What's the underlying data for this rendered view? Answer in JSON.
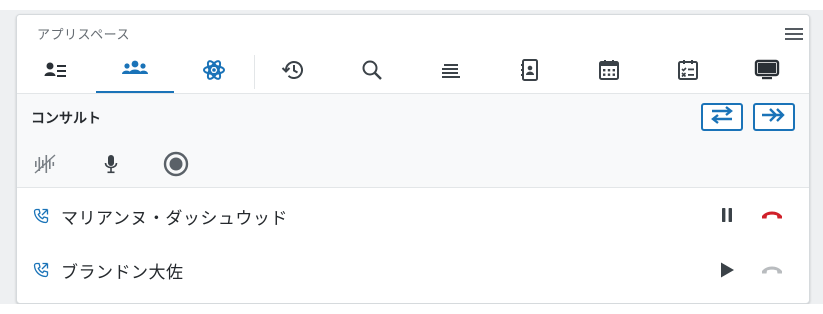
{
  "header": {
    "title": "アプリスペース",
    "menu_icon": "hamburger-menu-icon"
  },
  "tabs": [
    {
      "icon": "contact-card-icon",
      "active": false
    },
    {
      "icon": "people-group-icon",
      "active": true
    },
    {
      "icon": "atom-icon",
      "active": false
    },
    {
      "icon": "history-icon",
      "active": false
    },
    {
      "icon": "search-icon",
      "active": false
    },
    {
      "icon": "queue-list-icon",
      "active": false
    },
    {
      "icon": "address-book-icon",
      "active": false
    },
    {
      "icon": "calendar-icon",
      "active": false
    },
    {
      "icon": "checklist-icon",
      "active": false
    },
    {
      "icon": "monitor-icon",
      "active": false
    }
  ],
  "consult": {
    "title": "コンサルト",
    "actions": [
      "transfer-icon",
      "fast-forward-icon"
    ],
    "controls": [
      "waveform-muted-icon",
      "microphone-icon",
      "record-icon"
    ]
  },
  "calls": [
    {
      "name": "マリアンヌ・ダッシュウッド",
      "state": "active"
    },
    {
      "name": "ブランドン大佐",
      "state": "held"
    }
  ],
  "colors": {
    "accent": "#1a73b8",
    "hangup": "#d0202a",
    "hangup_disabled": "#b9bcbf",
    "icon": "#3b4248",
    "call_icon": "#1a73b8"
  }
}
